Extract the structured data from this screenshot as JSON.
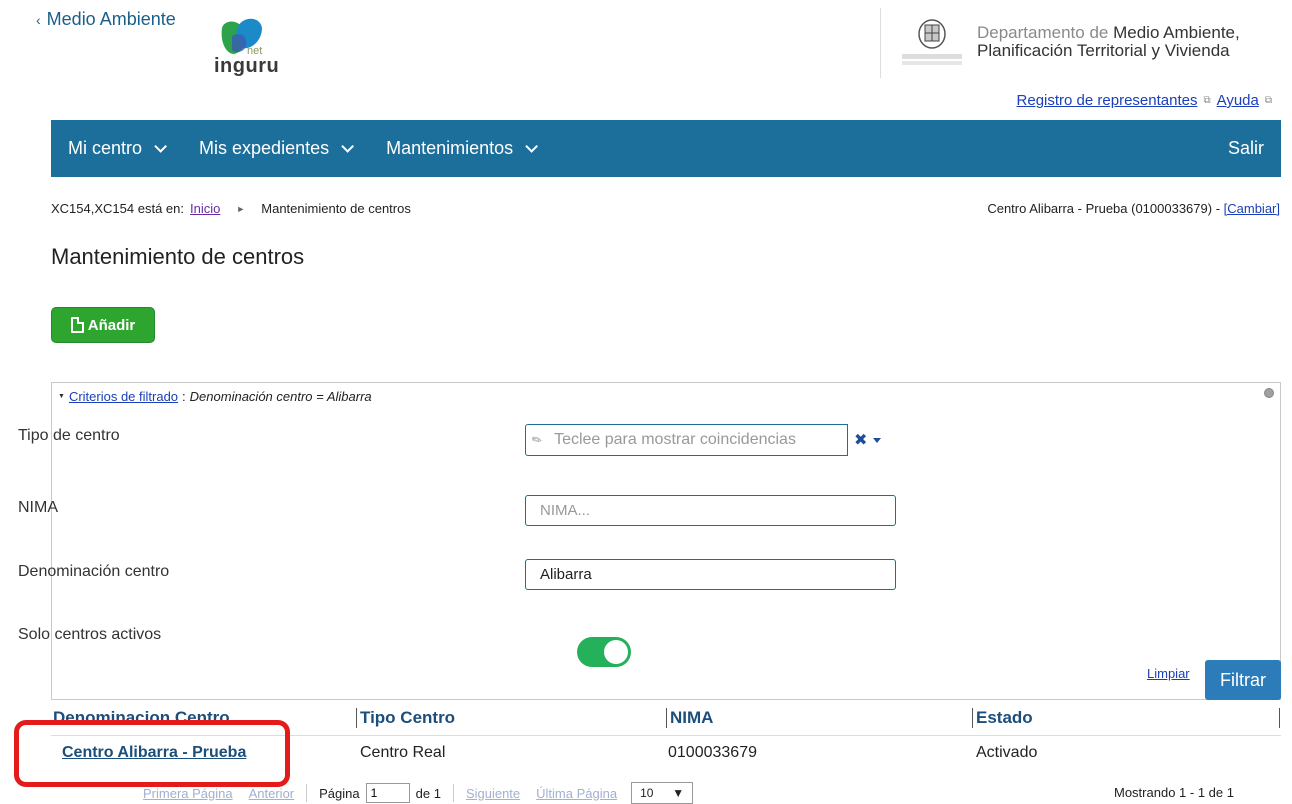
{
  "header": {
    "back_label": "Medio Ambiente",
    "logo_text": "inguru",
    "logo_net": "net",
    "dept_prefix": "Departamento de ",
    "dept_line1_rest": "Medio Ambiente,",
    "dept_line2": "Planificación Territorial y Vivienda",
    "links": [
      {
        "label": "Registro de representantes"
      },
      {
        "label": "Ayuda"
      }
    ]
  },
  "nav": {
    "items": [
      {
        "label": "Mi centro"
      },
      {
        "label": "Mis expedientes"
      },
      {
        "label": "Mantenimientos"
      }
    ],
    "logout": "Salir"
  },
  "breadcrumb": {
    "user_prefix": "XC154,XC154 está en:",
    "home": "Inicio",
    "current": "Mantenimiento de centros"
  },
  "centro_info": {
    "text": "Centro Alibarra - Prueba (0100033679) - ",
    "change_link": "[Cambiar]"
  },
  "page_title": "Mantenimiento de centros",
  "add_button": "Añadir",
  "filter": {
    "header_link": "Criterios de filtrado",
    "header_criteria": "Denominación centro = Alibarra",
    "fields": {
      "tipo_centro": {
        "label": "Tipo de centro",
        "placeholder": "Teclee para mostrar coincidencias"
      },
      "nima": {
        "label": "NIMA",
        "placeholder": "NIMA..."
      },
      "denominacion": {
        "label": "Denominación centro",
        "value": "Alibarra"
      },
      "solo_activos": {
        "label": "Solo centros activos",
        "checked": true
      }
    },
    "clear_label": "Limpiar",
    "submit_label": "Filtrar"
  },
  "table": {
    "columns": [
      "Denominacion Centro",
      "Tipo Centro",
      "NIMA",
      "Estado"
    ],
    "rows": [
      {
        "name": "Centro Alibarra - Prueba",
        "tipo": "Centro Real",
        "nima": "0100033679",
        "estado": "Activado"
      }
    ]
  },
  "pagination": {
    "first": "Primera Página",
    "prev": "Anterior",
    "page_label": "Página",
    "page_value": "1",
    "of_label": "de 1",
    "next": "Siguiente",
    "last": "Última Página",
    "page_size": "10",
    "showing": "Mostrando 1 - 1 de 1"
  },
  "colors": {
    "navbar": "#1c6e9b",
    "add_button": "#2ea52e",
    "toggle_on": "#25b05a",
    "highlight": "#e41b1b"
  }
}
